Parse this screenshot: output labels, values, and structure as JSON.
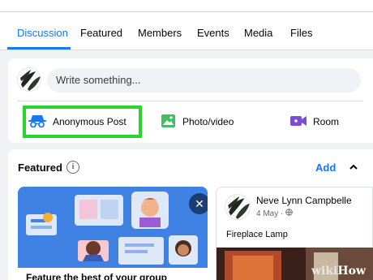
{
  "tabs": [
    {
      "label": "Discussion",
      "active": true
    },
    {
      "label": "Featured"
    },
    {
      "label": "Members"
    },
    {
      "label": "Events"
    },
    {
      "label": "Media"
    },
    {
      "label": "Files"
    }
  ],
  "composer": {
    "placeholder": "Write something...",
    "actions": [
      {
        "label": "Anonymous Post",
        "icon": "incognito-icon",
        "color": "#1877f2"
      },
      {
        "label": "Photo/video",
        "icon": "photo-icon",
        "color": "#45bd62"
      },
      {
        "label": "Room",
        "icon": "video-room-icon",
        "color": "#7b4ed9"
      }
    ],
    "highlight_color": "#29d52c"
  },
  "featured": {
    "title": "Featured",
    "add_label": "Add",
    "promo_text": "Feature the best of your group",
    "post": {
      "author": "Neve Lynn Campbelle",
      "meta": "4 May · ",
      "text": "Fireplace Lamp"
    }
  },
  "watermark": {
    "prefix": "wiki",
    "suffix": "How"
  }
}
